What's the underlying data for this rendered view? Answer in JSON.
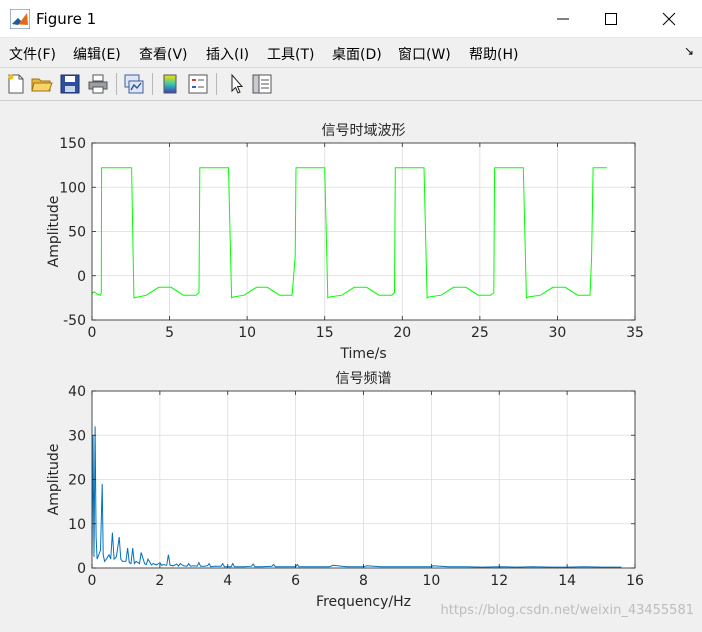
{
  "window": {
    "title": "Figure 1"
  },
  "menu": [
    {
      "label": "文件(F)"
    },
    {
      "label": "编辑(E)"
    },
    {
      "label": "查看(V)"
    },
    {
      "label": "插入(I)"
    },
    {
      "label": "工具(T)"
    },
    {
      "label": "桌面(D)"
    },
    {
      "label": "窗口(W)"
    },
    {
      "label": "帮助(H)"
    }
  ],
  "toolbar": [
    {
      "icon": "new-figure-icon"
    },
    {
      "icon": "open-file-icon"
    },
    {
      "icon": "save-icon"
    },
    {
      "icon": "print-icon"
    },
    {
      "icon": "link-plot-icon"
    },
    {
      "icon": "colorbar-icon"
    },
    {
      "icon": "legend-icon"
    },
    {
      "icon": "pointer-icon"
    },
    {
      "icon": "property-editor-icon"
    }
  ],
  "watermark": "https://blog.csdn.net/weixin_43455581",
  "colors": {
    "time_series": "#00ff00",
    "spectrum": "#0072bd",
    "grid": "#dcdcdc"
  },
  "chart_data": [
    {
      "type": "line",
      "title": "信号时域波形",
      "xlabel": "Time/s",
      "ylabel": "Amplitude",
      "xlim": [
        0,
        35
      ],
      "ylim": [
        -50,
        150
      ],
      "xticks": [
        0,
        5,
        10,
        15,
        20,
        25,
        30,
        35
      ],
      "yticks": [
        -50,
        0,
        50,
        100,
        150
      ],
      "grid": true,
      "series": [
        {
          "x": [
            0,
            0.15,
            0.35,
            0.55,
            0.6,
            0.62,
            2.4,
            2.55,
            2.7,
            3.5,
            4.3,
            5.1,
            5.9,
            6.7,
            6.9,
            6.95,
            8.8,
            9.0,
            9.1,
            9.8,
            10.6,
            11.3,
            12.1,
            12.9,
            13.1,
            13.15,
            15.0,
            15.2,
            15.3,
            16.1,
            16.9,
            17.7,
            18.5,
            19.3,
            19.5,
            19.55,
            21.4,
            21.6,
            21.7,
            22.5,
            23.3,
            24.1,
            24.9,
            25.7,
            25.9,
            25.95,
            27.8,
            28.0,
            28.1,
            28.9,
            29.7,
            30.5,
            31.3,
            32.1,
            32.2,
            32.3,
            33.2
          ],
          "y": [
            -20,
            -18,
            -21,
            -22,
            -19,
            122,
            122,
            122,
            -25,
            -22,
            -13,
            -13,
            -22,
            -22,
            -19,
            122,
            122,
            -25,
            -24,
            -22,
            -13,
            -13,
            -22,
            -22,
            22,
            122,
            122,
            -25,
            -24,
            -22,
            -13,
            -13,
            -22,
            -22,
            -19,
            122,
            122,
            -25,
            -24,
            -22,
            -13,
            -13,
            -22,
            -22,
            -19,
            122,
            122,
            -25,
            -24,
            -22,
            -13,
            -13,
            -22,
            -22,
            21,
            122,
            122
          ]
        }
      ]
    },
    {
      "type": "line",
      "title": "信号频谱",
      "xlabel": "Frequency/Hz",
      "ylabel": "Amplitude",
      "xlim": [
        0,
        16
      ],
      "ylim": [
        0,
        40
      ],
      "xticks": [
        0,
        2,
        4,
        6,
        8,
        10,
        12,
        14,
        16
      ],
      "yticks": [
        0,
        10,
        20,
        30,
        40
      ],
      "grid": true,
      "series": [
        {
          "x": [
            0,
            0.03,
            0.06,
            0.09,
            0.12,
            0.15,
            0.2,
            0.25,
            0.3,
            0.33,
            0.37,
            0.42,
            0.5,
            0.55,
            0.6,
            0.65,
            0.72,
            0.8,
            0.85,
            0.9,
            1.0,
            1.05,
            1.1,
            1.15,
            1.2,
            1.25,
            1.3,
            1.4,
            1.45,
            1.55,
            1.6,
            1.65,
            1.75,
            1.8,
            1.9,
            2.0,
            2.05,
            2.1,
            2.2,
            2.25,
            2.3,
            2.4,
            2.5,
            2.55,
            2.6,
            2.7,
            2.8,
            2.85,
            2.9,
            3.0,
            3.1,
            3.15,
            3.2,
            3.3,
            3.4,
            3.45,
            3.5,
            3.6,
            3.8,
            3.85,
            3.9,
            4.1,
            4.15,
            4.2,
            4.5,
            4.7,
            4.75,
            4.8,
            5.0,
            5.3,
            5.35,
            5.4,
            5.7,
            6.0,
            6.05,
            6.1,
            6.5,
            7.0,
            7.1,
            7.5,
            8.0,
            8.1,
            8.5,
            9.0,
            9.5,
            10.0,
            10.05,
            10.5,
            11.0,
            11.5,
            12.0,
            12.5,
            13.0,
            13.5,
            14.0,
            14.5,
            15.0,
            15.5,
            15.6
          ],
          "y": [
            3,
            30,
            2.5,
            32,
            7,
            2,
            3,
            4,
            19,
            3,
            1.5,
            2,
            3,
            2,
            8,
            2,
            2.5,
            7,
            2,
            1.5,
            1.5,
            4.5,
            1.2,
            1,
            4.5,
            1,
            1.5,
            1,
            3.5,
            1,
            0.8,
            2,
            0.7,
            1,
            0.7,
            1.2,
            0.6,
            0.8,
            0.6,
            3,
            0.6,
            0.5,
            0.9,
            0.4,
            1,
            0.5,
            0.4,
            1,
            0.4,
            0.5,
            0.4,
            1.2,
            0.4,
            0.4,
            0.5,
            1,
            0.3,
            0.4,
            0.4,
            1,
            0.3,
            0.3,
            1,
            0.3,
            0.3,
            0.4,
            0.9,
            0.3,
            0.3,
            0.4,
            0.8,
            0.3,
            0.3,
            0.3,
            0.8,
            0.3,
            0.3,
            0.3,
            0.6,
            0.3,
            0.3,
            0.5,
            0.3,
            0.3,
            0.3,
            0.3,
            0.5,
            0.3,
            0.3,
            0.2,
            0.3,
            0.2,
            0.3,
            0.2,
            0.2,
            0.3,
            0.2,
            0.2,
            0.2
          ]
        }
      ]
    }
  ]
}
